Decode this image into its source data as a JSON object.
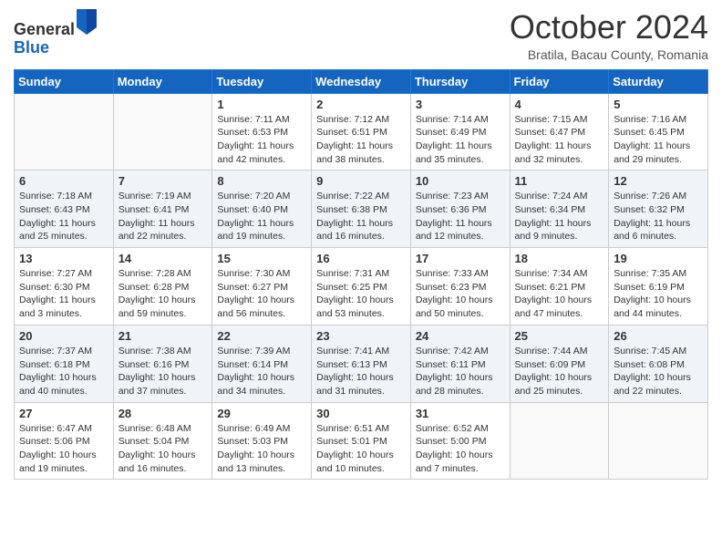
{
  "header": {
    "logo_general": "General",
    "logo_blue": "Blue",
    "month_title": "October 2024",
    "location": "Bratila, Bacau County, Romania"
  },
  "weekdays": [
    "Sunday",
    "Monday",
    "Tuesday",
    "Wednesday",
    "Thursday",
    "Friday",
    "Saturday"
  ],
  "weeks": [
    [
      {
        "day": "",
        "info": ""
      },
      {
        "day": "",
        "info": ""
      },
      {
        "day": "1",
        "info": "Sunrise: 7:11 AM\nSunset: 6:53 PM\nDaylight: 11 hours and 42 minutes."
      },
      {
        "day": "2",
        "info": "Sunrise: 7:12 AM\nSunset: 6:51 PM\nDaylight: 11 hours and 38 minutes."
      },
      {
        "day": "3",
        "info": "Sunrise: 7:14 AM\nSunset: 6:49 PM\nDaylight: 11 hours and 35 minutes."
      },
      {
        "day": "4",
        "info": "Sunrise: 7:15 AM\nSunset: 6:47 PM\nDaylight: 11 hours and 32 minutes."
      },
      {
        "day": "5",
        "info": "Sunrise: 7:16 AM\nSunset: 6:45 PM\nDaylight: 11 hours and 29 minutes."
      }
    ],
    [
      {
        "day": "6",
        "info": "Sunrise: 7:18 AM\nSunset: 6:43 PM\nDaylight: 11 hours and 25 minutes."
      },
      {
        "day": "7",
        "info": "Sunrise: 7:19 AM\nSunset: 6:41 PM\nDaylight: 11 hours and 22 minutes."
      },
      {
        "day": "8",
        "info": "Sunrise: 7:20 AM\nSunset: 6:40 PM\nDaylight: 11 hours and 19 minutes."
      },
      {
        "day": "9",
        "info": "Sunrise: 7:22 AM\nSunset: 6:38 PM\nDaylight: 11 hours and 16 minutes."
      },
      {
        "day": "10",
        "info": "Sunrise: 7:23 AM\nSunset: 6:36 PM\nDaylight: 11 hours and 12 minutes."
      },
      {
        "day": "11",
        "info": "Sunrise: 7:24 AM\nSunset: 6:34 PM\nDaylight: 11 hours and 9 minutes."
      },
      {
        "day": "12",
        "info": "Sunrise: 7:26 AM\nSunset: 6:32 PM\nDaylight: 11 hours and 6 minutes."
      }
    ],
    [
      {
        "day": "13",
        "info": "Sunrise: 7:27 AM\nSunset: 6:30 PM\nDaylight: 11 hours and 3 minutes."
      },
      {
        "day": "14",
        "info": "Sunrise: 7:28 AM\nSunset: 6:28 PM\nDaylight: 10 hours and 59 minutes."
      },
      {
        "day": "15",
        "info": "Sunrise: 7:30 AM\nSunset: 6:27 PM\nDaylight: 10 hours and 56 minutes."
      },
      {
        "day": "16",
        "info": "Sunrise: 7:31 AM\nSunset: 6:25 PM\nDaylight: 10 hours and 53 minutes."
      },
      {
        "day": "17",
        "info": "Sunrise: 7:33 AM\nSunset: 6:23 PM\nDaylight: 10 hours and 50 minutes."
      },
      {
        "day": "18",
        "info": "Sunrise: 7:34 AM\nSunset: 6:21 PM\nDaylight: 10 hours and 47 minutes."
      },
      {
        "day": "19",
        "info": "Sunrise: 7:35 AM\nSunset: 6:19 PM\nDaylight: 10 hours and 44 minutes."
      }
    ],
    [
      {
        "day": "20",
        "info": "Sunrise: 7:37 AM\nSunset: 6:18 PM\nDaylight: 10 hours and 40 minutes."
      },
      {
        "day": "21",
        "info": "Sunrise: 7:38 AM\nSunset: 6:16 PM\nDaylight: 10 hours and 37 minutes."
      },
      {
        "day": "22",
        "info": "Sunrise: 7:39 AM\nSunset: 6:14 PM\nDaylight: 10 hours and 34 minutes."
      },
      {
        "day": "23",
        "info": "Sunrise: 7:41 AM\nSunset: 6:13 PM\nDaylight: 10 hours and 31 minutes."
      },
      {
        "day": "24",
        "info": "Sunrise: 7:42 AM\nSunset: 6:11 PM\nDaylight: 10 hours and 28 minutes."
      },
      {
        "day": "25",
        "info": "Sunrise: 7:44 AM\nSunset: 6:09 PM\nDaylight: 10 hours and 25 minutes."
      },
      {
        "day": "26",
        "info": "Sunrise: 7:45 AM\nSunset: 6:08 PM\nDaylight: 10 hours and 22 minutes."
      }
    ],
    [
      {
        "day": "27",
        "info": "Sunrise: 6:47 AM\nSunset: 5:06 PM\nDaylight: 10 hours and 19 minutes."
      },
      {
        "day": "28",
        "info": "Sunrise: 6:48 AM\nSunset: 5:04 PM\nDaylight: 10 hours and 16 minutes."
      },
      {
        "day": "29",
        "info": "Sunrise: 6:49 AM\nSunset: 5:03 PM\nDaylight: 10 hours and 13 minutes."
      },
      {
        "day": "30",
        "info": "Sunrise: 6:51 AM\nSunset: 5:01 PM\nDaylight: 10 hours and 10 minutes."
      },
      {
        "day": "31",
        "info": "Sunrise: 6:52 AM\nSunset: 5:00 PM\nDaylight: 10 hours and 7 minutes."
      },
      {
        "day": "",
        "info": ""
      },
      {
        "day": "",
        "info": ""
      }
    ]
  ]
}
